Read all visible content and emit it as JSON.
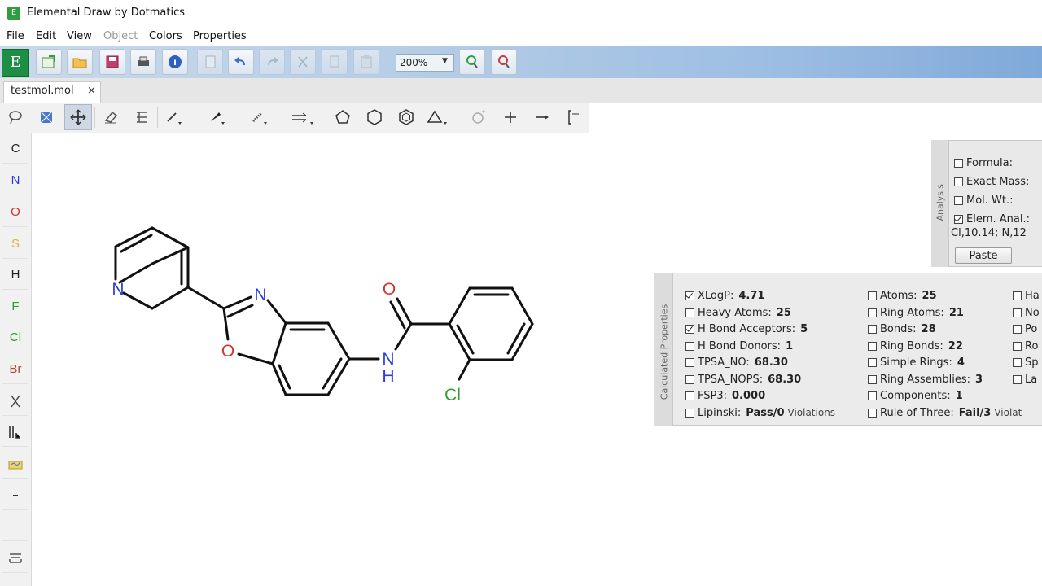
{
  "window": {
    "title": "Elemental Draw by Dotmatics",
    "app_icon": "E"
  },
  "menu": [
    "File",
    "Edit",
    "View",
    "Object",
    "Colors",
    "Properties"
  ],
  "toolbar": {
    "logo": "E",
    "zoom": "200%"
  },
  "tab": {
    "label": "testmol.mol",
    "close": "×"
  },
  "elements": [
    "C",
    "N",
    "O",
    "S",
    "H",
    "F",
    "Cl",
    "Br"
  ],
  "element_colors": {
    "C": "#222222",
    "N": "#2b3fd6",
    "O": "#d2322d",
    "S": "#d8b23a",
    "H": "#222222",
    "F": "#2aa02a",
    "Cl": "#2aa02a",
    "Br": "#b0443a"
  },
  "molecule": {
    "atoms": {
      "pyridine_n": "N",
      "oxazole_n": "N",
      "oxazole_o": "O",
      "carbonyl_o": "O",
      "amide_n": "N",
      "amide_h": "H",
      "chlorine": "Cl"
    }
  },
  "analysis": {
    "title": "Analysis",
    "rows": [
      {
        "label": "Formula:",
        "checked": false
      },
      {
        "label": "Exact Mass:",
        "checked": false
      },
      {
        "label": "Mol. Wt.:",
        "checked": false
      },
      {
        "label": "Elem. Anal.:",
        "checked": true
      }
    ],
    "result": "Cl,10.14; N,12",
    "paste": "Paste"
  },
  "properties": {
    "title": "Calculated Properties",
    "col1": [
      {
        "label": "XLogP:",
        "value": "4.71",
        "checked": true
      },
      {
        "label": "Heavy Atoms:",
        "value": "25",
        "checked": false
      },
      {
        "label": "H Bond Acceptors:",
        "value": "5",
        "checked": true
      },
      {
        "label": "H Bond Donors:",
        "value": "1",
        "checked": false
      },
      {
        "label": "TPSA_NO:",
        "value": "68.30",
        "checked": false
      },
      {
        "label": "TPSA_NOPS:",
        "value": "68.30",
        "checked": false
      },
      {
        "label": "FSP3:",
        "value": "0.000",
        "checked": false
      },
      {
        "label": "Lipinski:",
        "value": "Pass/0",
        "note": "Violations",
        "checked": false
      }
    ],
    "col2": [
      {
        "label": "Atoms:",
        "value": "25",
        "checked": false
      },
      {
        "label": "Ring Atoms:",
        "value": "21",
        "checked": false
      },
      {
        "label": "Bonds:",
        "value": "28",
        "checked": false
      },
      {
        "label": "Ring Bonds:",
        "value": "22",
        "checked": false
      },
      {
        "label": "Simple Rings:",
        "value": "4",
        "checked": false
      },
      {
        "label": "Ring Assemblies:",
        "value": "3",
        "checked": false
      },
      {
        "label": "Components:",
        "value": "1",
        "checked": false
      },
      {
        "label": "Rule of Three:",
        "value": "Fail/3",
        "note": "Violat",
        "checked": false
      }
    ],
    "col3": [
      "Ha",
      "No",
      "Po",
      "Ro",
      "Sp",
      "La"
    ]
  }
}
